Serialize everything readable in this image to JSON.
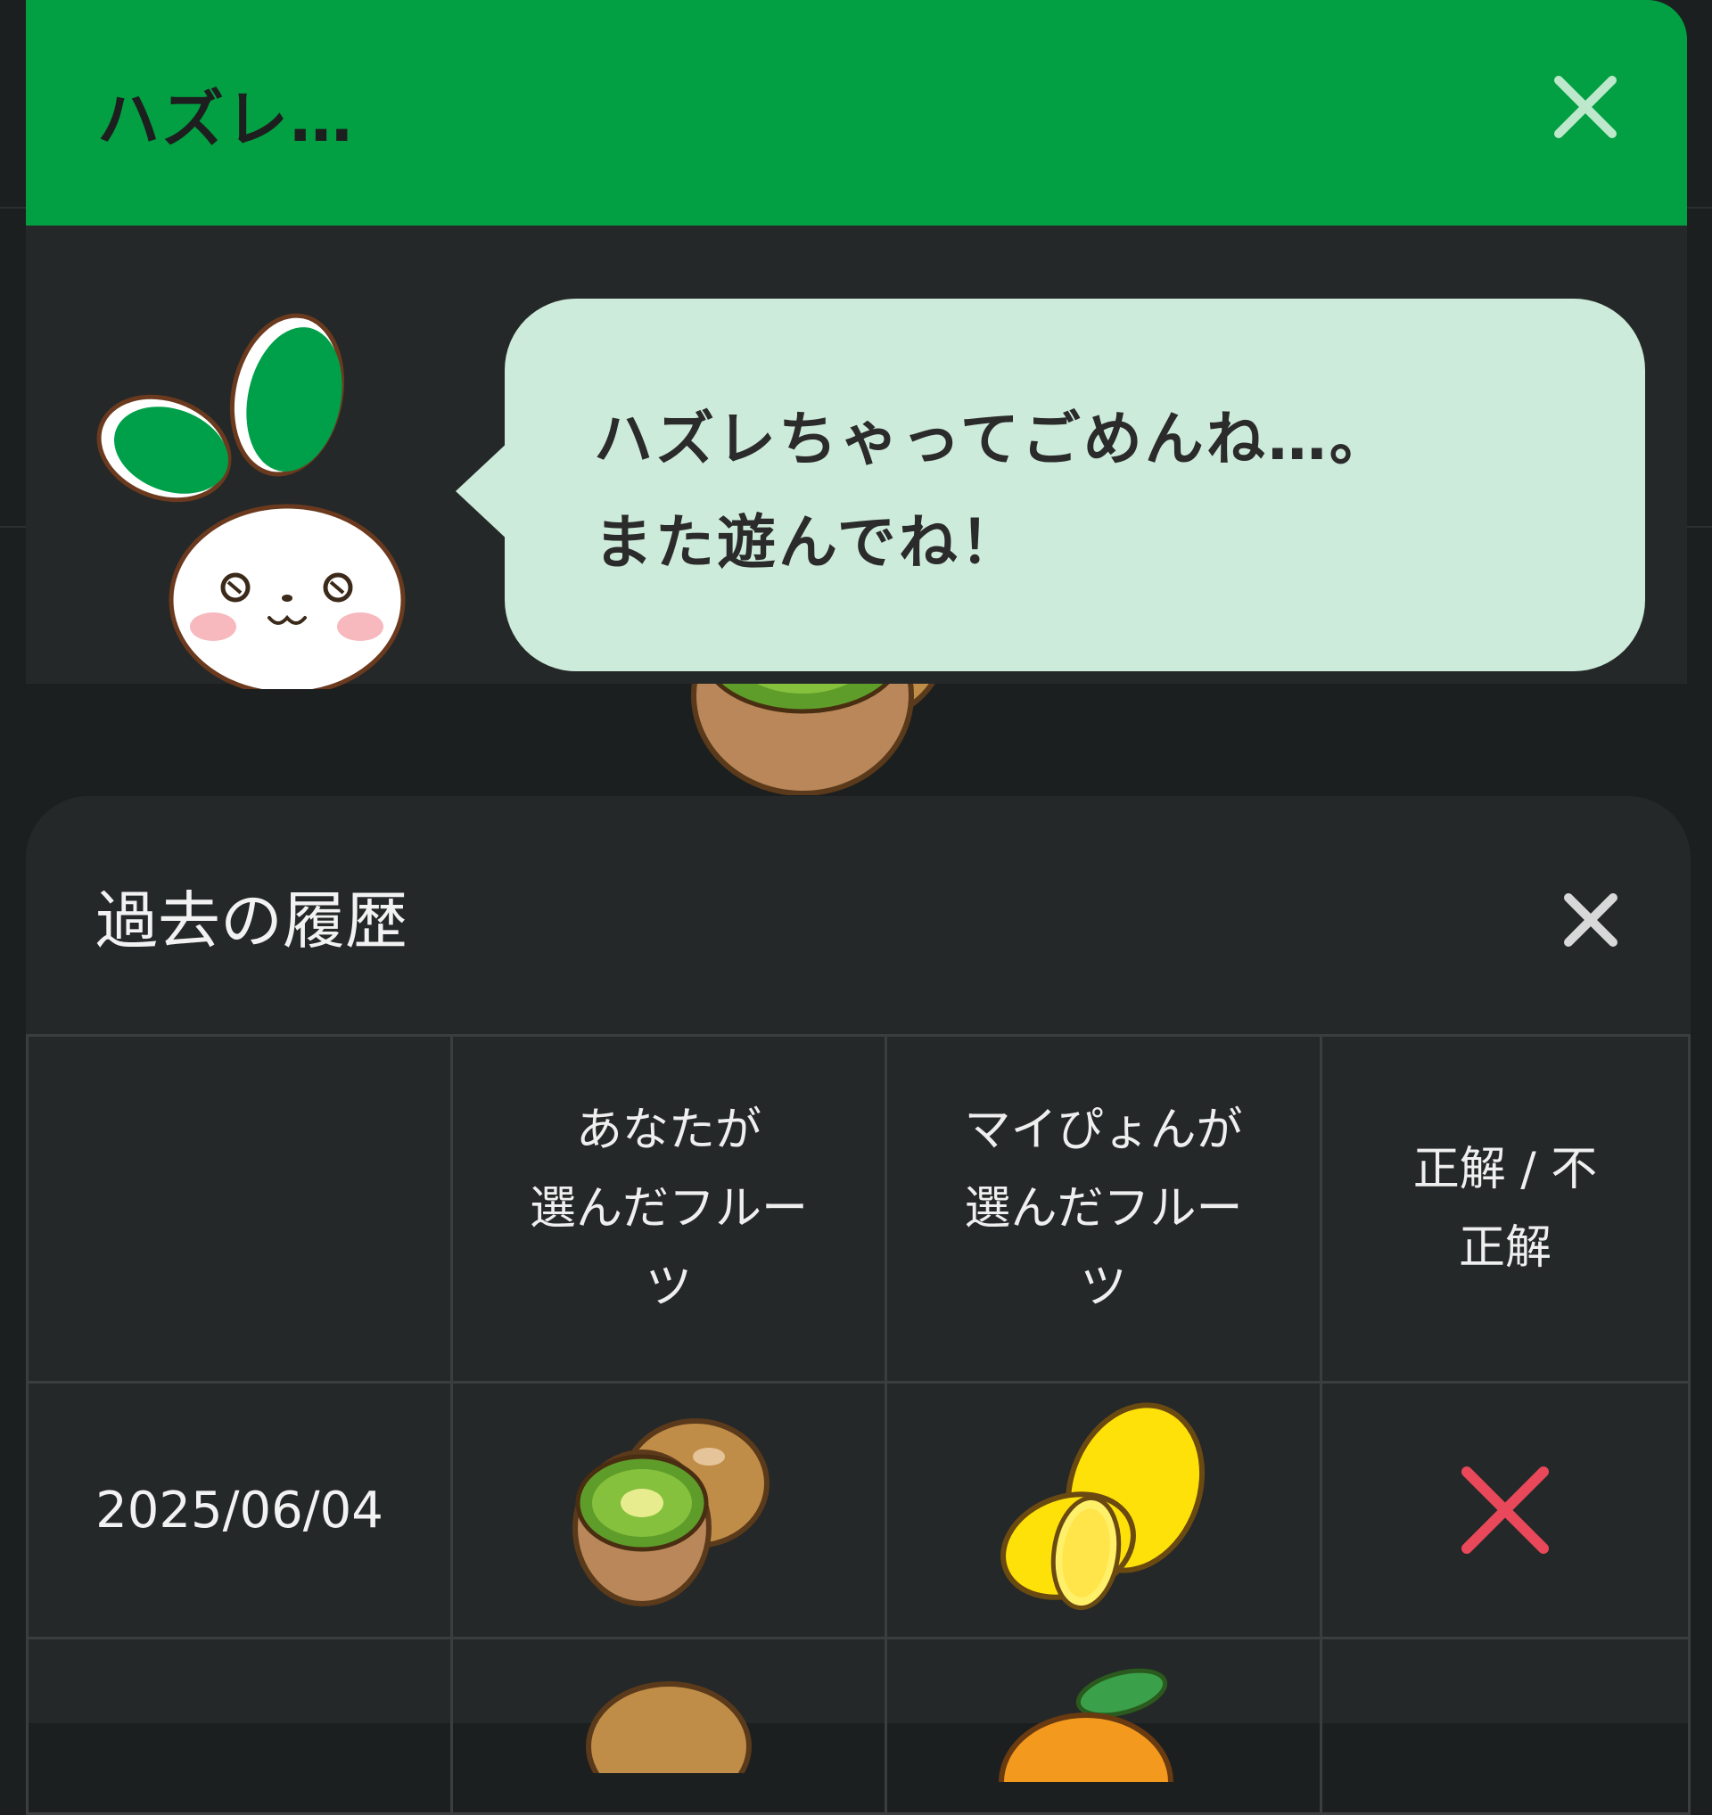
{
  "result_dialog": {
    "title": "ハズレ…",
    "message_line1": "ハズレちゃってごめんね…。",
    "message_line2": "また遊んでね！",
    "header_color": "#02a043",
    "bubble_color": "#cdebdb"
  },
  "history": {
    "title": "過去の履歴",
    "columns": [
      "",
      "あなたが\n選んだフルー\nツ",
      "マイぴょんが\n選んだフルー\nツ",
      "正解 / 不\n正解"
    ],
    "col_lines": {
      "your_pick": [
        "あなたが",
        "選んだフルー",
        "ツ"
      ],
      "mypyon_pick": [
        "マイぴょんが",
        "選んだフルー",
        "ツ"
      ],
      "result": [
        "正解 / 不",
        "正解"
      ]
    },
    "rows": [
      {
        "date": "2025/06/04",
        "your_fruit_icon": "kiwi-icon",
        "mypyon_fruit_icon": "lemon-icon",
        "result_icon": "cross-icon"
      },
      {
        "date": "",
        "your_fruit_icon": "kiwi-icon",
        "mypyon_fruit_icon": "orange-icon",
        "result_icon": ""
      }
    ],
    "wrong_color": "#e8485a"
  }
}
